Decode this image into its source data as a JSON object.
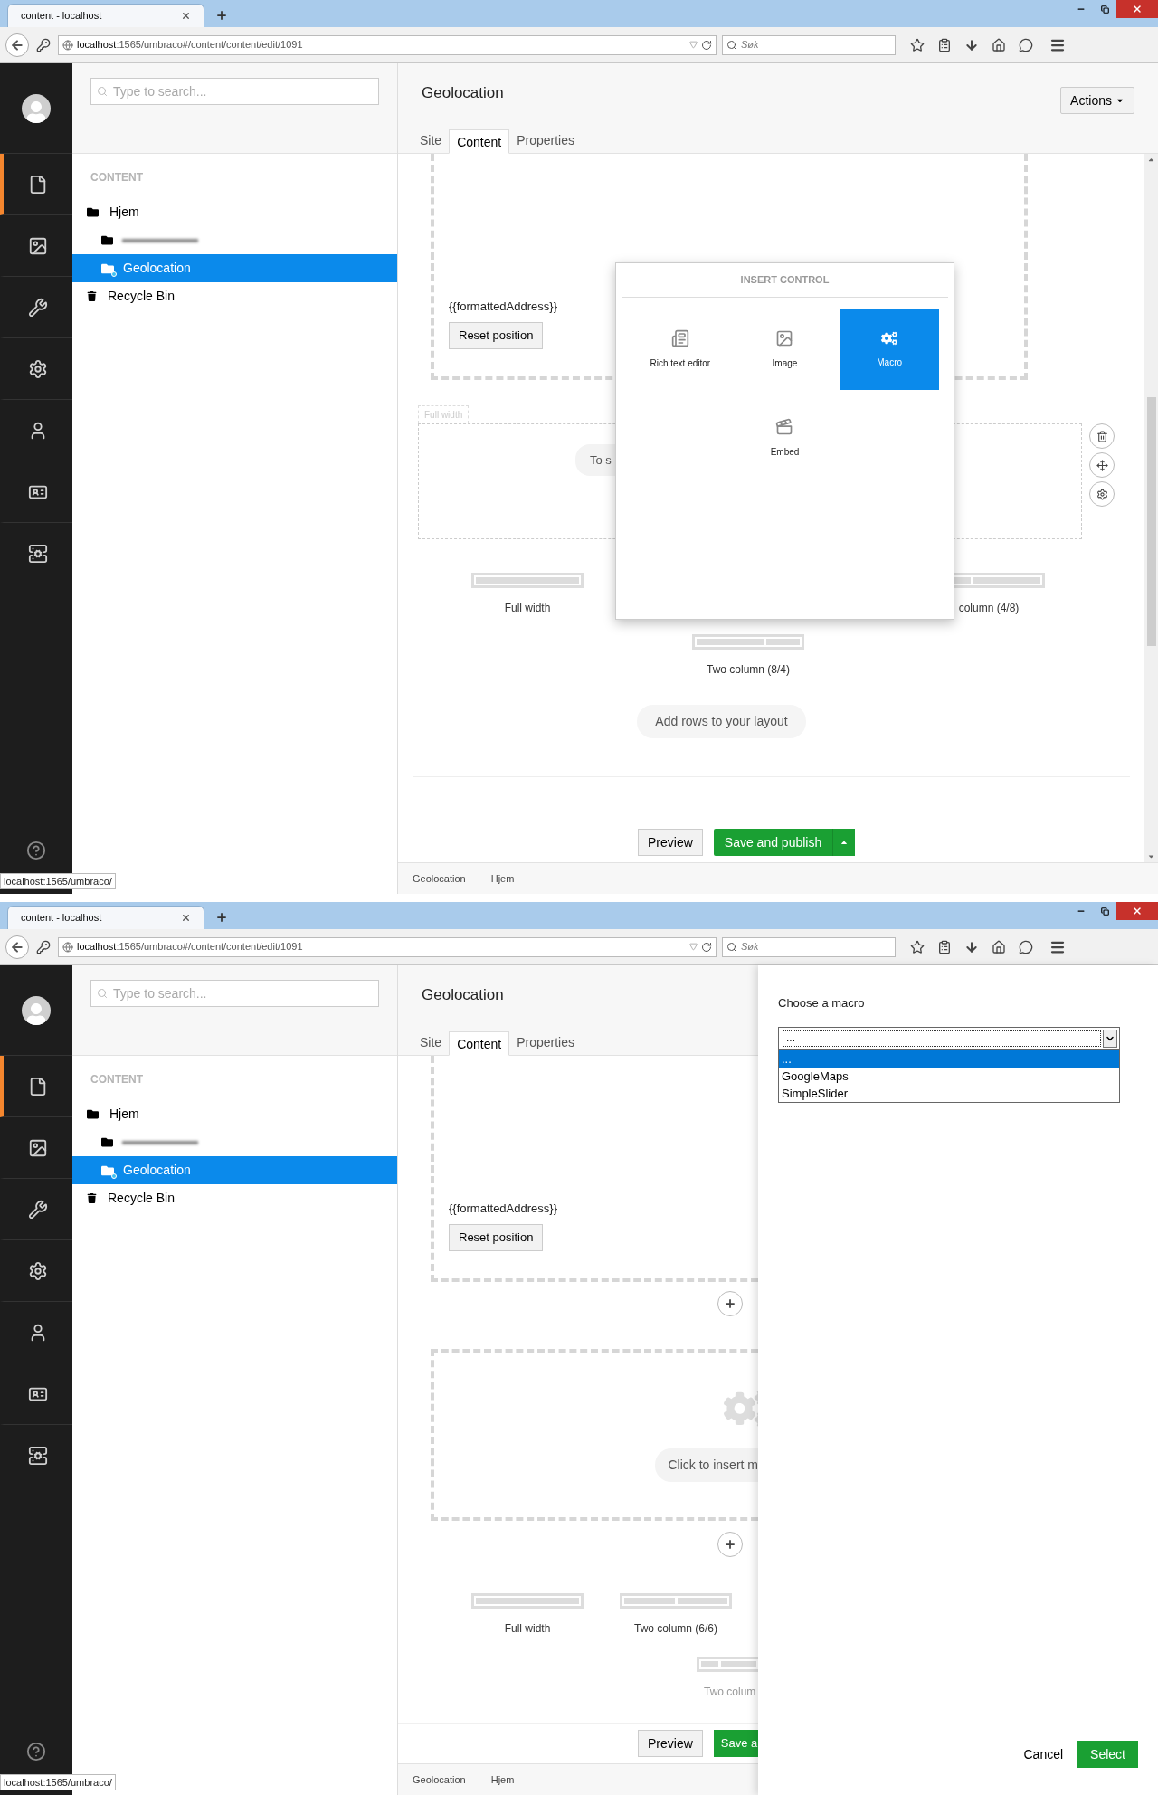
{
  "screens": [
    {
      "browser": {
        "tab_title": "content - localhost",
        "url_host": "localhost",
        "url_path": ":1565/umbraco#/content/content/edit/1091",
        "search_placeholder": "Søk"
      },
      "sections": [
        {
          "selected": true
        },
        {
          "selected": false
        },
        {
          "selected": false
        },
        {
          "selected": false
        },
        {
          "selected": false
        },
        {
          "selected": false
        },
        {
          "selected": false
        }
      ],
      "tree_search": {
        "placeholder": "Type to search..."
      },
      "tree": {
        "heading": "CONTENT",
        "items": [
          {
            "kind": "folder",
            "label": "Hjem",
            "selected": false,
            "children": [
              {
                "kind": "redacted",
                "selected": false
              },
              {
                "kind": "folder-new",
                "label": "Geolocation",
                "selected": true
              }
            ]
          },
          {
            "kind": "bin",
            "label": "Recycle Bin",
            "selected": false
          }
        ]
      },
      "editor": {
        "title": "Geolocation",
        "actions": "Actions",
        "tabs": [
          {
            "label": "Site",
            "selected": false
          },
          {
            "label": "Content",
            "selected": true
          },
          {
            "label": "Properties",
            "selected": false
          }
        ]
      },
      "blocks": [
        {
          "kind": "address-box",
          "address": "{{formattedAddress}}",
          "button": "Reset position",
          "add_below": false
        },
        {
          "kind": "row-box",
          "label": "Full width",
          "pill": "To s"
        },
        {
          "kind": "layouts",
          "rows": [
            [
              {
                "kind": "full",
                "label": "Full width"
              },
              {
                "kind": "two-4-8",
                "label": "column (4/8)"
              }
            ],
            [
              {
                "kind": "two-8-4",
                "label": "Two column (8/4)"
              }
            ]
          ]
        },
        {
          "kind": "add-rows",
          "label": "Add rows to your layout"
        }
      ],
      "buttons": {
        "preview": "Preview",
        "save": "Save and publish",
        "save_split": true
      },
      "breadcrumbs": [
        "Geolocation",
        "Hjem"
      ],
      "status_url": "localhost:1565/umbraco/",
      "overlay": {
        "kind": "insert-control",
        "title": "INSERT CONTROL",
        "items": [
          {
            "label": "Rich text editor",
            "selected": false
          },
          {
            "label": "Image",
            "selected": false
          },
          {
            "label": "Macro",
            "selected": true
          },
          {
            "label": "Embed",
            "selected": false
          }
        ]
      }
    },
    {
      "browser": {
        "tab_title": "content - localhost",
        "url_host": "localhost",
        "url_path": ":1565/umbraco#/content/content/edit/1091",
        "search_placeholder": "Søk"
      },
      "sections": [
        {
          "selected": true
        },
        {
          "selected": false
        },
        {
          "selected": false
        },
        {
          "selected": false
        },
        {
          "selected": false
        },
        {
          "selected": false
        },
        {
          "selected": false
        }
      ],
      "tree_search": {
        "placeholder": "Type to search..."
      },
      "tree": {
        "heading": "CONTENT",
        "items": [
          {
            "kind": "folder",
            "label": "Hjem",
            "selected": false,
            "children": [
              {
                "kind": "redacted",
                "selected": false
              },
              {
                "kind": "folder-new",
                "label": "Geolocation",
                "selected": true
              }
            ]
          },
          {
            "kind": "bin",
            "label": "Recycle Bin",
            "selected": false
          }
        ]
      },
      "editor": {
        "title": "Geolocation",
        "tabs": [
          {
            "label": "Site",
            "selected": false
          },
          {
            "label": "Content",
            "selected": true
          },
          {
            "label": "Properties",
            "selected": false
          }
        ]
      },
      "blocks": [
        {
          "kind": "address-box",
          "address": "{{formattedAddress}}",
          "button": "Reset position",
          "add_below": true
        },
        {
          "kind": "macro-box",
          "pill": "Click to insert m",
          "add_below": true
        },
        {
          "kind": "layouts",
          "rows": [
            [
              {
                "kind": "full",
                "label": "Full width"
              },
              {
                "kind": "two-6-6",
                "label": "Two column (6/6)"
              }
            ],
            [
              {
                "kind": "two-4-8",
                "label": "Two colum"
              }
            ]
          ]
        }
      ],
      "buttons": {
        "preview": "Preview",
        "save": "Save a",
        "save_split": false
      },
      "breadcrumbs": [
        "Geolocation",
        "Hjem"
      ],
      "status_url": "localhost:1565/umbraco/",
      "overlay": {
        "kind": "macro-dialog",
        "title": "Choose a macro",
        "select_value": "...",
        "options": [
          {
            "label": "...",
            "selected": true
          },
          {
            "label": "GoogleMaps",
            "selected": false
          },
          {
            "label": "SimpleSlider",
            "selected": false
          }
        ],
        "cancel": "Cancel",
        "submit": "Select"
      }
    }
  ]
}
